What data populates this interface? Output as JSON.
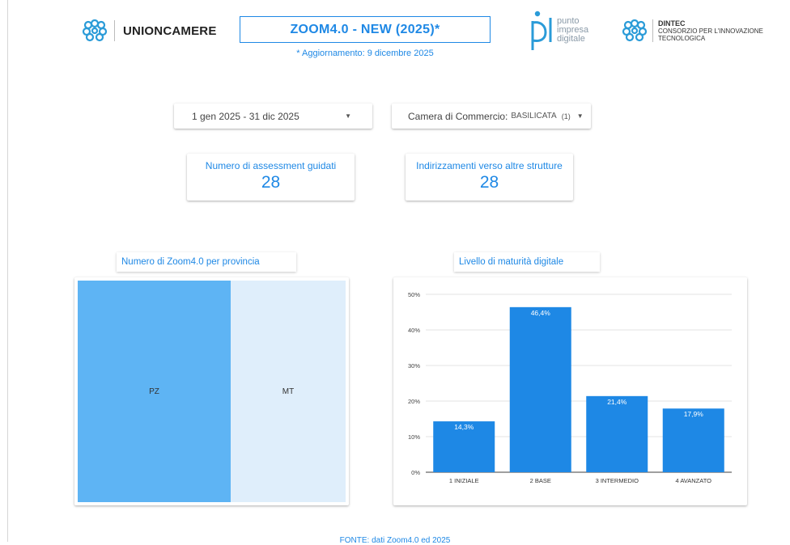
{
  "header": {
    "left_logo_text": "UNIONCAMERE",
    "title": "ZOOM4.0 - NEW (2025)*",
    "subtitle": "* Aggiornamento: 9 dicembre 2025",
    "pid_logo_lines": [
      "punto",
      "impresa",
      "digitale"
    ],
    "dintec_name": "DINTEC",
    "dintec_lines": [
      "CONSORZIO PER L'INNOVAZIONE",
      "TECNOLOGICA"
    ]
  },
  "filters": {
    "date_range": "1 gen 2025 - 31 dic 2025",
    "chamber_label": "Camera di Commercio:",
    "chamber_value": "BASILICATA",
    "chamber_count": "(1)"
  },
  "kpis": {
    "guided": {
      "label": "Numero di assessment guidati",
      "value": "28"
    },
    "referrals": {
      "label": "Indirizzamenti verso altre strutture",
      "value": "28"
    }
  },
  "treemap": {
    "title": "Numero di Zoom4.0 per provincia",
    "cells": [
      {
        "label": "PZ",
        "share": 0.57,
        "color": "#5eb4f4"
      },
      {
        "label": "MT",
        "share": 0.43,
        "color": "#dfeefb"
      }
    ]
  },
  "maturity": {
    "title": "Livello di maturità digitale"
  },
  "chart_data": {
    "type": "bar",
    "categories": [
      "1 INIZIALE",
      "2 BASE",
      "3 INTERMEDIO",
      "4 AVANZATO"
    ],
    "values": [
      14.3,
      46.4,
      21.4,
      17.9
    ],
    "value_labels": [
      "14,3%",
      "46,4%",
      "21,4%",
      "17,9%"
    ],
    "yticks": [
      "0%",
      "10%",
      "20%",
      "30%",
      "40%",
      "50%"
    ],
    "ylim": [
      0,
      50
    ],
    "bar_color": "#1e88e5",
    "grid": true
  },
  "footer": {
    "text": "FONTE: dati Zoom4.0 ed 2025"
  },
  "colors": {
    "accent": "#1e88e5"
  }
}
